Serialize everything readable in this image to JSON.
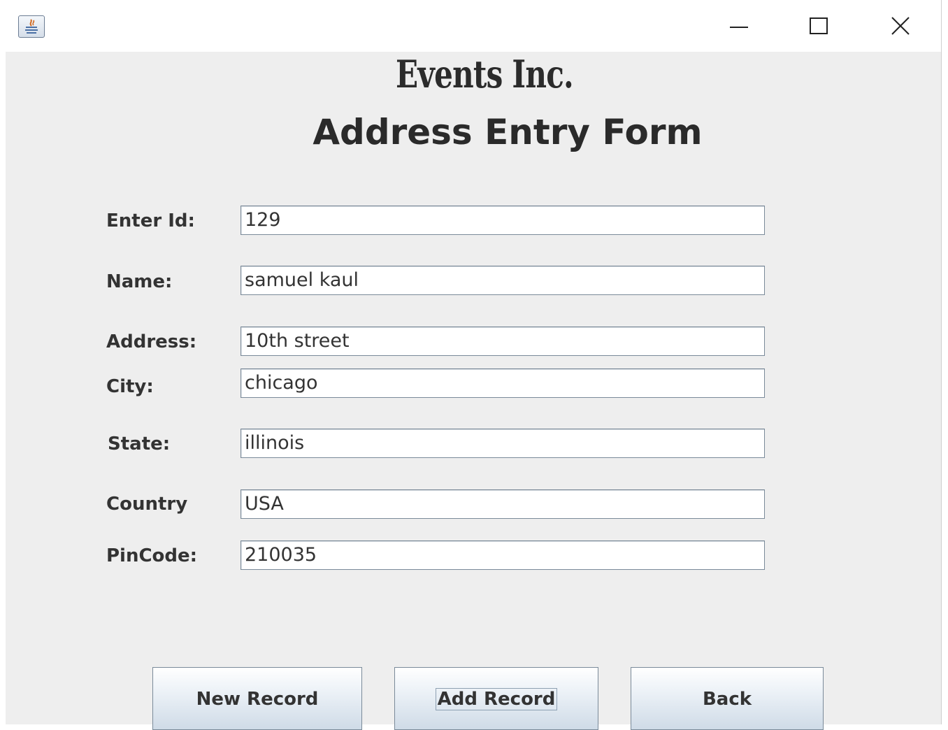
{
  "window": {
    "app_icon": "java-icon",
    "controls": {
      "minimize": "minimize-icon",
      "maximize": "maximize-icon",
      "close": "close-icon"
    }
  },
  "header": {
    "brand": "Events Inc.",
    "title": "Address Entry Form"
  },
  "form": {
    "fields": [
      {
        "label": "Enter Id:",
        "value": "129"
      },
      {
        "label": "Name:",
        "value": "samuel kaul"
      },
      {
        "label": "Address:",
        "value": "10th street"
      },
      {
        "label": "City:",
        "value": "chicago"
      },
      {
        "label": "State:",
        "value": "illinois"
      },
      {
        "label": "Country",
        "value": "USA"
      },
      {
        "label": "PinCode:",
        "value": "210035"
      }
    ]
  },
  "buttons": {
    "new_record": "New Record",
    "add_record": "Add Record",
    "back": "Back"
  },
  "colors": {
    "window_bg": "#eeeeee",
    "title_text": "#2a2a2a",
    "field_border": "#7a8a99"
  }
}
